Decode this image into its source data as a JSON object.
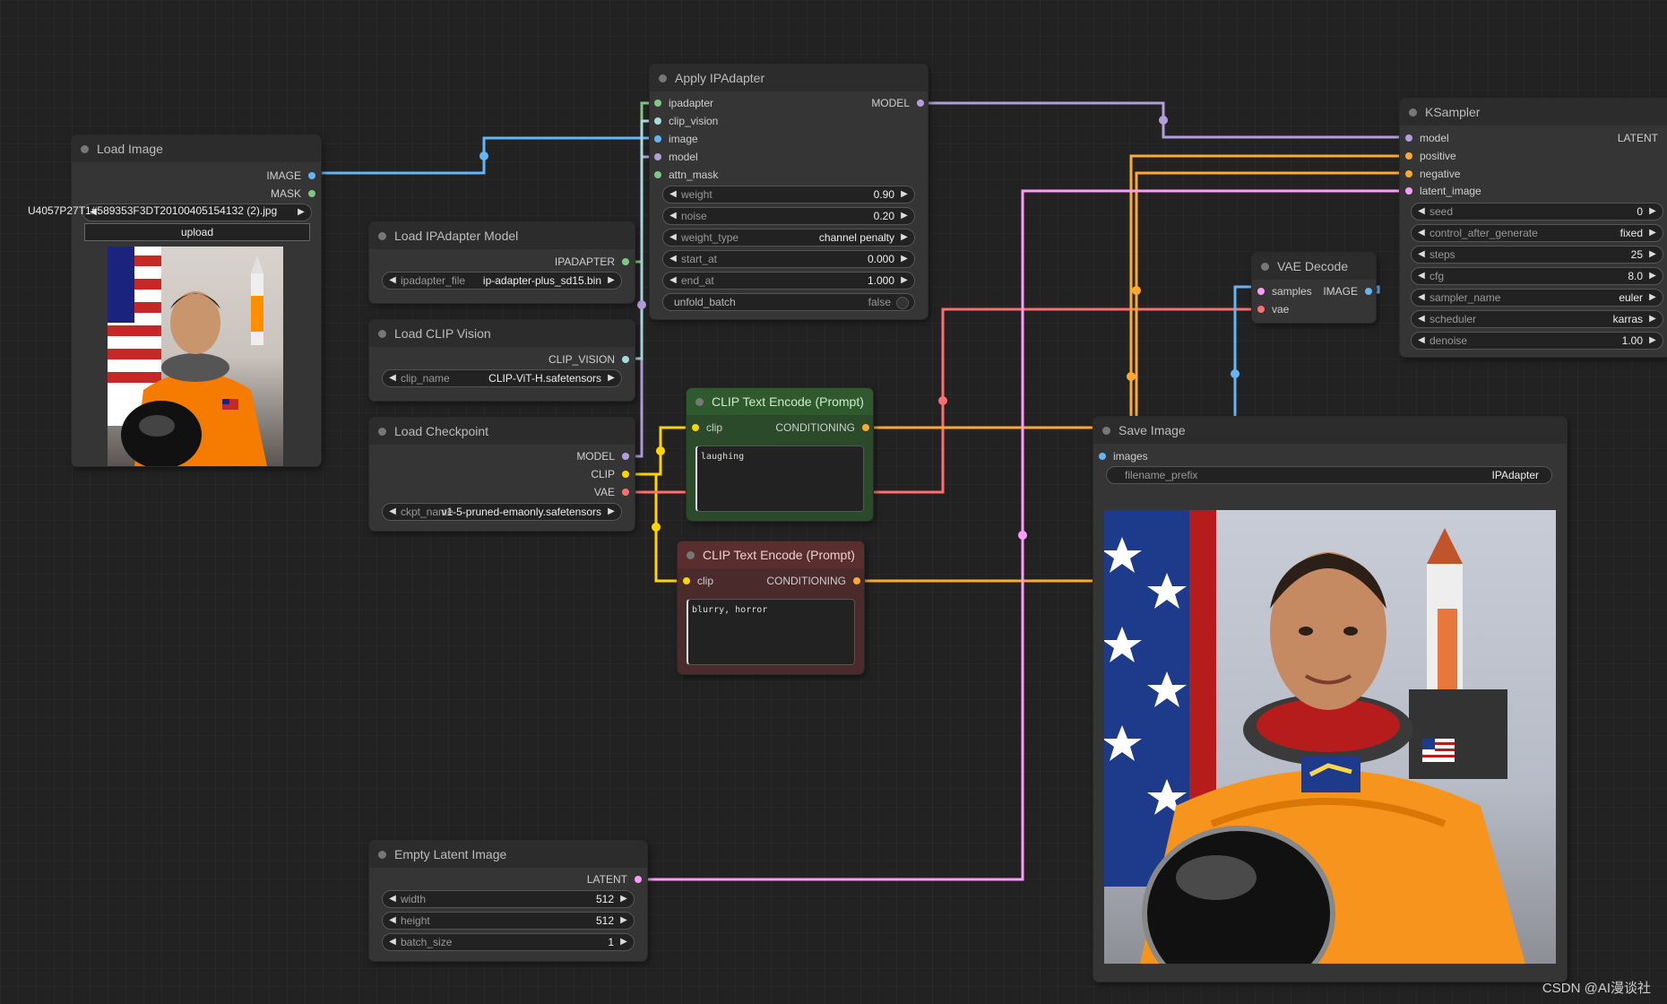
{
  "colors": {
    "background": "#222222",
    "model": "#b39ddb",
    "clip": "#ffd500",
    "vae": "#ff6e6e",
    "image": "#64b5f6",
    "latent": "#ff9cf9",
    "conditioning": "#ffa931",
    "clip_vision": "#a8dadc",
    "mask": "#81c784",
    "green_node": "#2a4a2a",
    "red_node": "#4a2a2a"
  },
  "load_image": {
    "title": "Load Image",
    "outputs": [
      "IMAGE",
      "MASK"
    ],
    "filename": "U4057P27T1#589353F3DT20100405154132 (2).jpg",
    "upload_label": "upload",
    "preview_icon": "astronaut-photo"
  },
  "ipadapter_model": {
    "title": "Load IPAdapter Model",
    "output": "IPADAPTER",
    "widget_label": "ipadapter_file",
    "widget_value": "ip-adapter-plus_sd15.bin"
  },
  "clip_vision": {
    "title": "Load CLIP Vision",
    "output": "CLIP_VISION",
    "widget_label": "clip_name",
    "widget_value": "CLIP-ViT-H.safetensors"
  },
  "checkpoint": {
    "title": "Load Checkpoint",
    "outputs": [
      "MODEL",
      "CLIP",
      "VAE"
    ],
    "widget_label": "ckpt_name",
    "widget_value": "v1-5-pruned-emaonly.safetensors"
  },
  "apply_ipadapter": {
    "title": "Apply IPAdapter",
    "inputs": [
      "ipadapter",
      "clip_vision",
      "image",
      "model",
      "attn_mask"
    ],
    "output": "MODEL",
    "widgets": [
      {
        "label": "weight",
        "value": "0.90"
      },
      {
        "label": "noise",
        "value": "0.20"
      },
      {
        "label": "weight_type",
        "value": "channel penalty"
      },
      {
        "label": "start_at",
        "value": "0.000"
      },
      {
        "label": "end_at",
        "value": "1.000"
      }
    ],
    "toggle_label": "unfold_batch",
    "toggle_value": "false"
  },
  "clip_pos": {
    "title": "CLIP Text Encode (Prompt)",
    "input": "clip",
    "output": "CONDITIONING",
    "text": "laughing"
  },
  "clip_neg": {
    "title": "CLIP Text Encode (Prompt)",
    "input": "clip",
    "output": "CONDITIONING",
    "text": "blurry, horror"
  },
  "empty_latent": {
    "title": "Empty Latent Image",
    "output": "LATENT",
    "widgets": [
      {
        "label": "width",
        "value": "512"
      },
      {
        "label": "height",
        "value": "512"
      },
      {
        "label": "batch_size",
        "value": "1"
      }
    ]
  },
  "vae_decode": {
    "title": "VAE Decode",
    "inputs": [
      "samples",
      "vae"
    ],
    "output": "IMAGE"
  },
  "ksampler": {
    "title": "KSampler",
    "inputs": [
      "model",
      "positive",
      "negative",
      "latent_image"
    ],
    "output": "LATENT",
    "widgets": [
      {
        "label": "seed",
        "value": "0"
      },
      {
        "label": "control_after_generate",
        "value": "fixed"
      },
      {
        "label": "steps",
        "value": "25"
      },
      {
        "label": "cfg",
        "value": "8.0"
      },
      {
        "label": "sampler_name",
        "value": "euler"
      },
      {
        "label": "scheduler",
        "value": "karras"
      },
      {
        "label": "denoise",
        "value": "1.00"
      }
    ]
  },
  "save_image": {
    "title": "Save Image",
    "input": "images",
    "widget_label": "filename_prefix",
    "widget_value": "IPAdapter",
    "preview_icon": "generated-astronaut-image"
  },
  "watermark": "CSDN @AI漫谈社"
}
